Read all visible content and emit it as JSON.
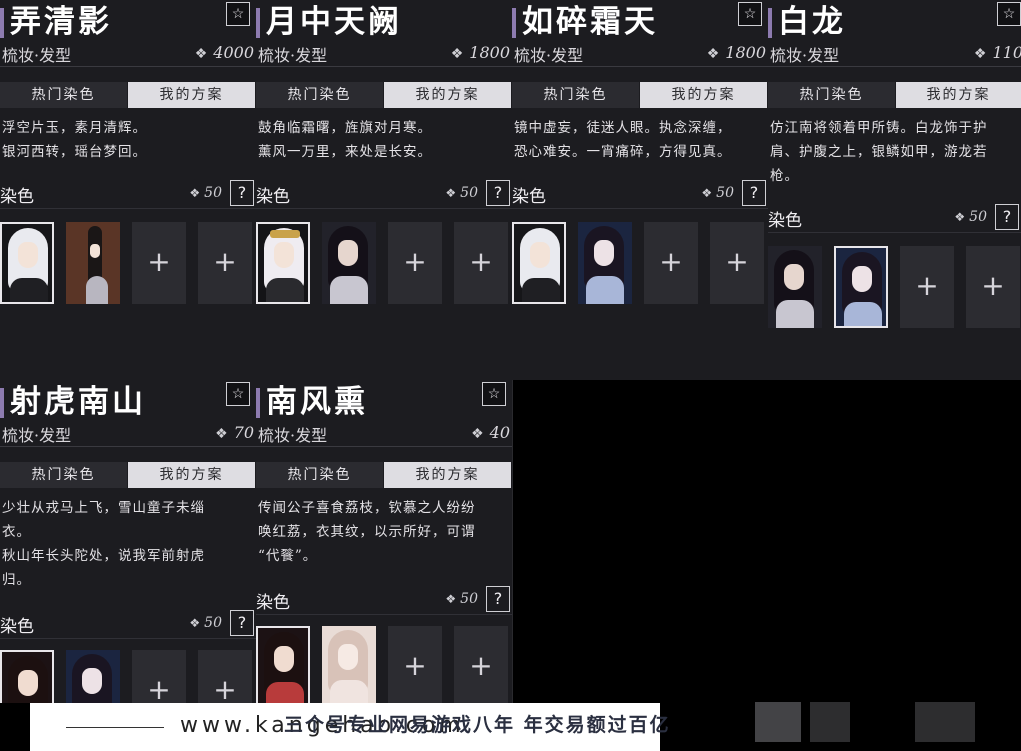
{
  "panels": [
    {
      "title": "弄清影",
      "subtitle": "梳妆·发型",
      "price": "4000",
      "tab_hot": "热门染色",
      "tab_mine": "我的方案",
      "desc": [
        "浮空片玉，素月清辉。",
        "银河西转，瑶台梦回。"
      ],
      "dye_label": "染色",
      "dye_price": "50",
      "help": "?",
      "slots": [
        "white-hair",
        "door-figure",
        "+",
        "+"
      ]
    },
    {
      "title": "月中天阙",
      "subtitle": "梳妆·发型",
      "price": "1800",
      "tab_hot": "热门染色",
      "tab_mine": "我的方案",
      "desc": [
        "鼓角临霜曙，旌旗对月寒。",
        "薰风一万里，来处是长安。"
      ],
      "dye_label": "染色",
      "dye_price": "50",
      "help": "?",
      "slots": [
        "gold-crown",
        "dark-hair",
        "+",
        "+"
      ]
    },
    {
      "title": "如碎霜天",
      "subtitle": "梳妆·发型",
      "price": "1800",
      "tab_hot": "热门染色",
      "tab_mine": "我的方案",
      "desc": [
        "镜中虚妄，徒迷人眼。执念深缠，",
        "恐心难安。一宵痛碎，方得见真。"
      ],
      "dye_label": "染色",
      "dye_price": "50",
      "help": "?",
      "slots": [
        "white-hair",
        "blue-robe",
        "+",
        "+"
      ]
    },
    {
      "title": "白龙",
      "subtitle": "梳妆·发型",
      "price": "110",
      "tab_hot": "热门染色",
      "tab_mine": "我的方案",
      "desc": [
        "仿江南将领着甲所铸。白龙饰于护",
        "肩、护腹之上，银鳞如甲，游龙若",
        "枪。"
      ],
      "dye_label": "染色",
      "dye_price": "50",
      "help": "?",
      "slots": [
        "dark-hair",
        "blue-robe",
        "+",
        "+"
      ]
    },
    {
      "title": "射虎南山",
      "subtitle": "梳妆·发型",
      "price": "70",
      "tab_hot": "热门染色",
      "tab_mine": "我的方案",
      "desc": [
        "少壮从戎马上飞，雪山童子未缁",
        "衣。",
        "秋山年长头陀处，说我军前射虎",
        "归。"
      ],
      "dye_label": "染色",
      "dye_price": "50",
      "help": "?",
      "slots": [
        "red-robe",
        "blue-robe",
        "+",
        "+"
      ]
    },
    {
      "title": "南风熏",
      "subtitle": "梳妆·发型",
      "price": "40",
      "tab_hot": "热门染色",
      "tab_mine": "我的方案",
      "desc": [
        "传闻公子喜食荔枝，钦慕之人纷纷",
        "唤红荔，衣其纹，以示所好，可谓",
        "“代餮”。"
      ],
      "dye_label": "染色",
      "dye_price": "50",
      "help": "?",
      "slots": [
        "red-robe",
        "pink-robe",
        "+",
        "+"
      ]
    }
  ],
  "footer": {
    "url": "www.kangehao.com",
    "slogan": "三个号专业网易游戏八年  年交易额过百亿"
  },
  "icons": {
    "star": "star-icon",
    "gem": "gem-icon",
    "help": "question-icon",
    "add": "plus-icon"
  }
}
